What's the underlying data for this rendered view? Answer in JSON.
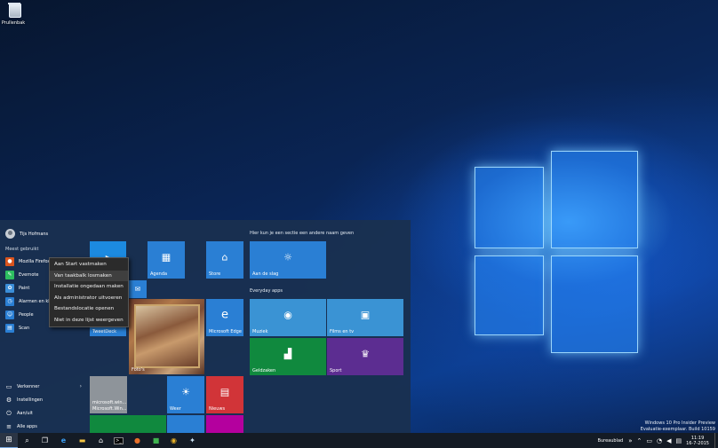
{
  "desktop": {
    "recycle_bin": "Prullenbak"
  },
  "start": {
    "user": "Tijs Hofmans",
    "most_used_header": "Meest gebruikt",
    "apps": [
      {
        "label": "Mozilla Firefox",
        "icon": "firefox-icon",
        "color": "#d9541e"
      },
      {
        "label": "Evernote",
        "icon": "evernote-icon",
        "color": "#2dbe60"
      },
      {
        "label": "Paint",
        "icon": "paint-icon",
        "color": "#3b8ed8"
      },
      {
        "label": "Alarmen en klok",
        "icon": "alarm-icon",
        "color": "#2a7fd4"
      },
      {
        "label": "People",
        "icon": "people-icon",
        "color": "#2a7fd4"
      },
      {
        "label": "Scan",
        "icon": "scan-icon",
        "color": "#2a7fd4"
      }
    ],
    "bottom": {
      "explorer": "Verkenner",
      "settings": "Instellingen",
      "power": "Aan/uit",
      "all_apps": "Alle apps"
    },
    "section1_header": "Hier kun je een sectie een andere naam geven",
    "section2_header": "Everyday apps",
    "tiles": {
      "agenda": "Agenda",
      "store": "Store",
      "aan_de_slag": "Aan de slag",
      "tweetdeck": "TweetDeck",
      "edge": "Microsoft Edge",
      "muziek": "Muziek",
      "films": "Films en tv",
      "foto": "Foto's",
      "geldzaken": "Geldzaken",
      "sport": "Sport",
      "microsoft_line1": "microsoft.win...",
      "microsoft_line2": "Microsoft.Win...",
      "weer": "Weer",
      "nieuws": "Nieuws"
    }
  },
  "context_menu": [
    "Aan Start vastmaken",
    "Van taakbalk losmaken",
    "Installatie ongedaan maken",
    "Als administrator uitvoeren",
    "Bestandslocatie openen",
    "Niet in deze lijst weergeven"
  ],
  "watermark": {
    "line1": "Windows 10 Pro Insider Preview",
    "line2": "Evaluatie-exemplaar. Build 10159"
  },
  "taskbar": {
    "desktop_label": "Bureaublad",
    "time": "11:19",
    "date": "16-7-2015"
  }
}
